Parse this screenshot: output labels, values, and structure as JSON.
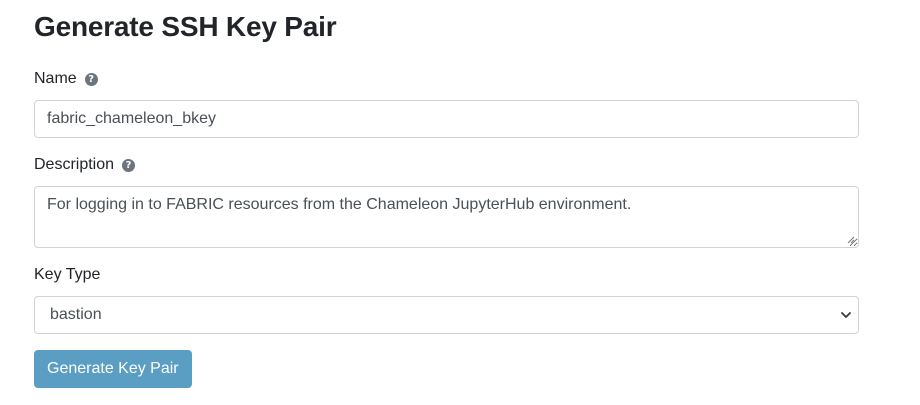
{
  "page": {
    "title": "Generate SSH Key Pair"
  },
  "form": {
    "name": {
      "label": "Name",
      "help_icon": "question-circle-icon",
      "value": "fabric_chameleon_bkey"
    },
    "description": {
      "label": "Description",
      "help_icon": "question-circle-icon",
      "value": "For logging in to FABRIC resources from the Chameleon JupyterHub environment."
    },
    "key_type": {
      "label": "Key Type",
      "selected": "bastion"
    },
    "submit_label": "Generate Key Pair"
  },
  "colors": {
    "button_bg": "#5b9ec4",
    "help_icon": "#6c757d",
    "input_border": "#ced4da"
  }
}
